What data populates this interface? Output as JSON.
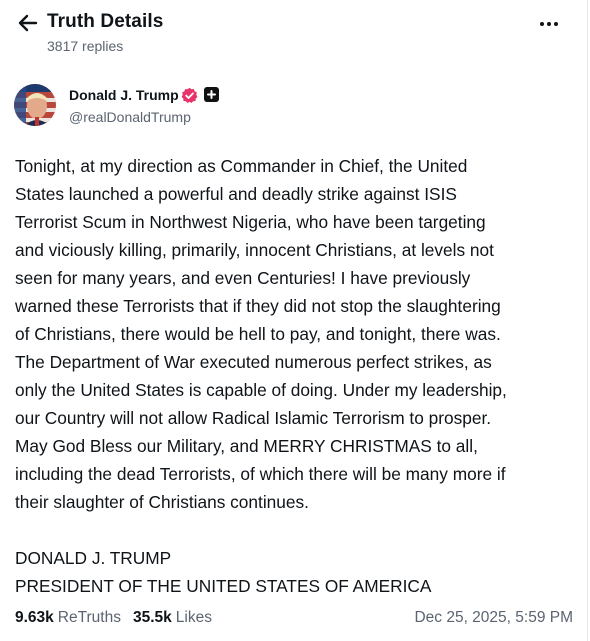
{
  "header": {
    "title": "Truth Details",
    "replies": "3817 replies"
  },
  "author": {
    "name": "Donald J. Trump",
    "handle": "@realDonaldTrump",
    "verified_color": "#e8336a"
  },
  "post": {
    "lines": [
      "Tonight, at my direction as Commander in Chief, the United",
      "States launched a powerful and deadly strike against ISIS",
      "Terrorist Scum in Northwest Nigeria, who have been targeting",
      "and viciously killing, primarily, innocent Christians, at levels not",
      "seen for many years, and even Centuries! I have previously",
      "warned these Terrorists that if they did not stop the slaughtering",
      "of Christians, there would be hell to pay, and tonight, there was.",
      "The Department of War executed numerous perfect strikes, as",
      "only the United States is capable of doing. Under my leadership,",
      "our Country will not allow Radical Islamic Terrorism to prosper.",
      "May God Bless our Military, and MERRY CHRISTMAS to all,",
      "including the dead Terrorists, of which there will be many more if",
      "their slaughter of Christians continues."
    ],
    "signature": [
      "DONALD J. TRUMP",
      "PRESIDENT OF THE UNITED STATES OF AMERICA"
    ]
  },
  "stats": {
    "retruths_count": "9.63k",
    "retruths_label": "ReTruths",
    "likes_count": "35.5k",
    "likes_label": "Likes",
    "timestamp": "Dec 25, 2025, 5:59 PM"
  }
}
